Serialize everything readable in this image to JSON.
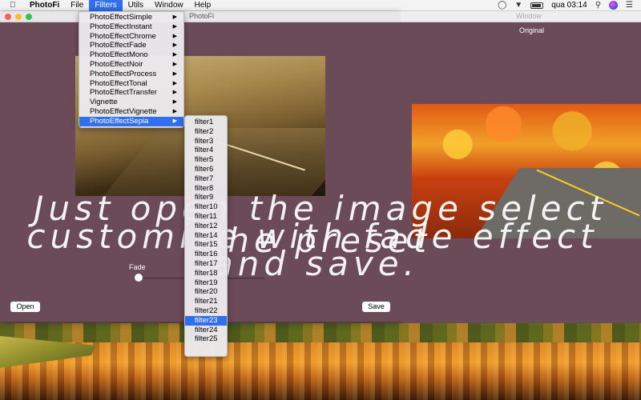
{
  "menubar": {
    "app_name": "PhotoFi",
    "items": [
      "File",
      "Filters",
      "Utils",
      "Window",
      "Help"
    ],
    "active_item": "Filters",
    "clock": "qua 03:14"
  },
  "main_window": {
    "title": "PhotoFi",
    "fade_label": "Fade",
    "fade_value": 0.0,
    "open_label": "Open",
    "save_label": "Save"
  },
  "second_window": {
    "title": "Window",
    "original_label": "Original"
  },
  "promo": {
    "line1": "Just open the image select the preset",
    "line2": "customize with fade effect",
    "line3": "and save."
  },
  "filters_menu": {
    "items": [
      "PhotoEffectSimple",
      "PhotoEffectInstant",
      "PhotoEffectChrome",
      "PhotoEffectFade",
      "PhotoEffectMono",
      "PhotoEffectNoir",
      "PhotoEffectProcess",
      "PhotoEffectTonal",
      "PhotoEffectTransfer",
      "Vignette",
      "PhotoEffectVignette",
      "PhotoEffectSepia"
    ],
    "selected_index": 11
  },
  "sepia_submenu": {
    "items": [
      "filter1",
      "filter2",
      "filter3",
      "filter4",
      "filter5",
      "filter6",
      "filter7",
      "filter8",
      "filter9",
      "filter10",
      "filter11",
      "filter12",
      "filter14",
      "filter15",
      "filter16",
      "filter17",
      "filter18",
      "filter19",
      "filter20",
      "filter21",
      "filter22",
      "filter23",
      "filter24",
      "filter25"
    ],
    "selected_index": 21
  },
  "colors": {
    "accent": "#2f6ff0",
    "window_bg": "#6b4b58"
  }
}
